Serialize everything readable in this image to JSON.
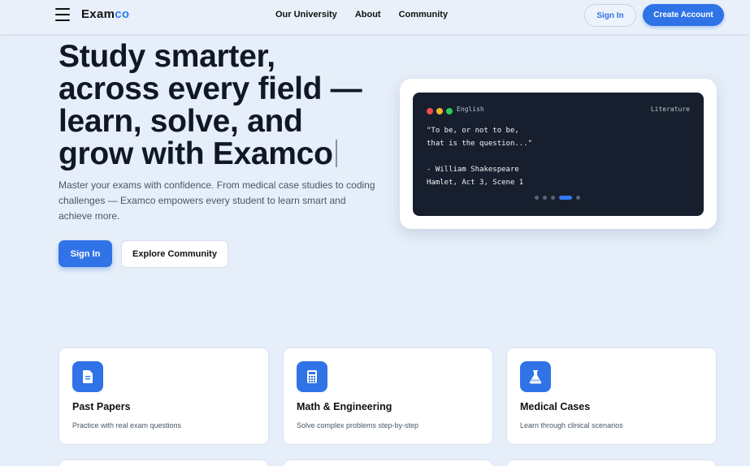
{
  "brand": {
    "name_main": "Exam",
    "name_accent": "co",
    "accent_color": "#2f7bf3"
  },
  "nav": {
    "items": [
      "Our University",
      "About",
      "Community"
    ]
  },
  "header": {
    "signin_label": "Sign In",
    "create_label": "Create Account"
  },
  "hero": {
    "title_lines": [
      "Study smarter,",
      "across every field —",
      "learn, solve, and",
      "grow with Examco"
    ],
    "subtitle": "Master your exams with confidence. From medical case studies to coding challenges — Examco empowers every student to learn smart and achieve more.",
    "signin_label": "Sign In",
    "explore_label": "Explore Community"
  },
  "code_card": {
    "language": "English",
    "tag": "Literature",
    "lines": [
      "\"To be, or not to be,",
      "that is the question...\"",
      "",
      "- William Shakespeare",
      "Hamlet, Act 3, Scene 1"
    ],
    "pager_count": 5,
    "pager_active": 3,
    "dot_colors": [
      "#ee4b4b",
      "#f4b526",
      "#2fc95a"
    ]
  },
  "features": [
    {
      "title": "Past Papers",
      "desc": "Practice with real exam questions",
      "icon": "document-icon"
    },
    {
      "title": "Math & Engineering",
      "desc": "Solve complex problems step-by-step",
      "icon": "calculator-icon"
    },
    {
      "title": "Medical Cases",
      "desc": "Learn through clinical scenarios",
      "icon": "flask-icon"
    }
  ],
  "colors": {
    "primary": "#2f73e6",
    "background": "#e6eef9",
    "code_bg": "#171f2e"
  }
}
